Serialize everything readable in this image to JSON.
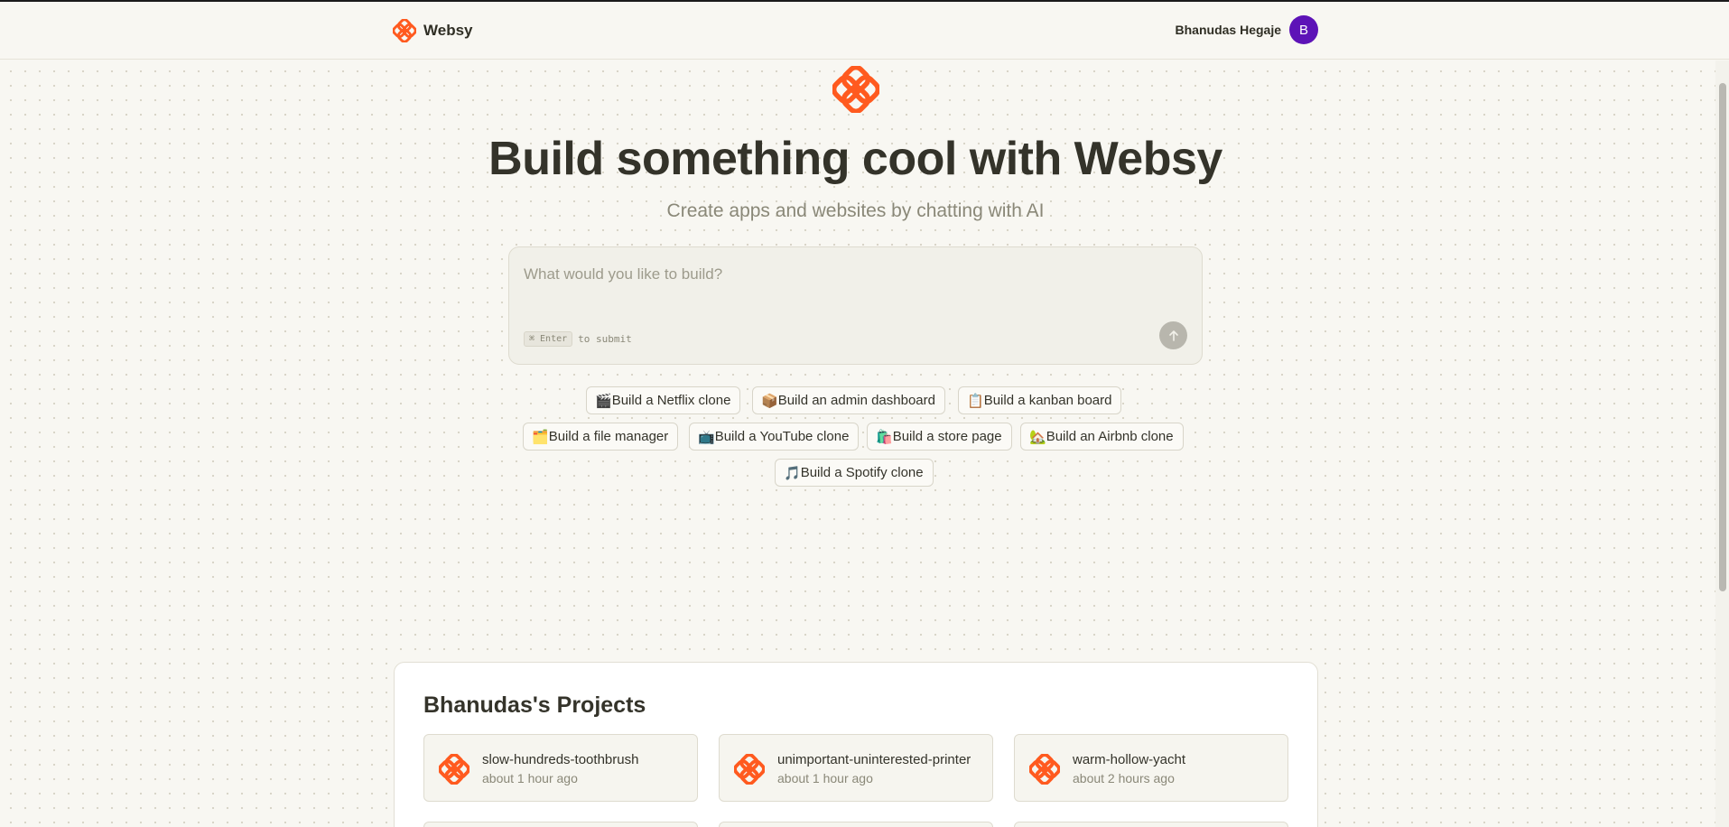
{
  "app": {
    "name": "Websy"
  },
  "user": {
    "name": "Bhanudas Hegaje",
    "initial": "B",
    "avatar_color": "#5d13b7"
  },
  "colors": {
    "brand": "#ff5a1f",
    "background": "#f8f7f2"
  },
  "hero": {
    "title": "Build something cool with Websy",
    "subtitle": "Create apps and websites by chatting with AI"
  },
  "prompt": {
    "placeholder": "What would you like to build?",
    "value": "",
    "shortcut_key": "⌘ Enter",
    "shortcut_text": "to submit",
    "submit_icon": "arrow-up-icon"
  },
  "suggestions": [
    {
      "emoji": "🎬",
      "label": "Build a Netflix clone"
    },
    {
      "emoji": "📦",
      "label": "Build an admin dashboard"
    },
    {
      "emoji": "📋",
      "label": "Build a kanban board"
    },
    {
      "emoji": "🗂️",
      "label": "Build a file manager"
    },
    {
      "emoji": "📺",
      "label": "Build a YouTube clone"
    },
    {
      "emoji": "🛍️",
      "label": "Build a store page"
    },
    {
      "emoji": "🏡",
      "label": "Build an Airbnb clone"
    },
    {
      "emoji": "🎵",
      "label": "Build a Spotify clone"
    }
  ],
  "projects": {
    "title": "Bhanudas's Projects",
    "items": [
      {
        "name": "slow-hundreds-toothbrush",
        "time": "about 1 hour ago"
      },
      {
        "name": "unimportant-uninterested-printer",
        "time": "about 1 hour ago"
      },
      {
        "name": "warm-hollow-yacht",
        "time": "about 2 hours ago"
      }
    ]
  }
}
